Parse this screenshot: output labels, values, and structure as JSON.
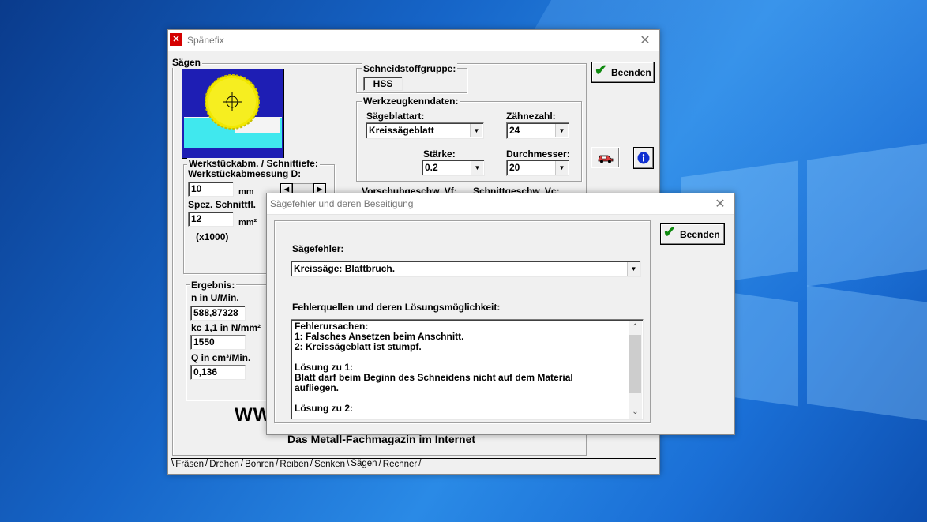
{
  "desktop": {
    "colors": {
      "accent": "#1a6fd6",
      "dark": "#0a3b8c"
    }
  },
  "main_window": {
    "title": "Spänefix",
    "saw_group_label": "Sägen",
    "cutting_material": {
      "label": "Schneidstoffgruppe:",
      "value": "HSS"
    },
    "tool_data": {
      "label": "Werkzeugkenndaten:",
      "blade_type_label": "Sägeblattart:",
      "blade_type_value": "Kreissägeblatt",
      "teeth_label": "Zähnezahl:",
      "teeth_value": "24",
      "thickness_label": "Stärke:",
      "thickness_value": "0.2",
      "diameter_label": "Durchmesser:",
      "diameter_value": "20"
    },
    "workpiece": {
      "label": "Werkstückabm. / Schnittiefe:",
      "dimension_label": "Werkstückabmessung D:",
      "dimension_value": "10",
      "dimension_unit": "mm",
      "specific_label": "Spez. Schnittfl.",
      "specific_value": "12",
      "specific_unit": "mm²",
      "multiplier": "(x1000)"
    },
    "feed_label": "Vorschubgeschw. Vf:",
    "cut_speed_label": "Schnittgeschw. Vc:",
    "result": {
      "label": "Ergebnis:",
      "n_label": "n in U/Min.",
      "n_value": "588,87328",
      "kc_label": "kc 1,1 in N/mm²",
      "kc_value": "1550",
      "q_label": "Q in cm³/Min.",
      "q_value": "0,136"
    },
    "banner_fragment": "WW",
    "tagline": "Das Metall-Fachmagazin im Internet",
    "end_button": "Beenden",
    "tabs": [
      "Fräsen",
      "Drehen",
      "Bohren",
      "Reiben",
      "Senken",
      "Sägen",
      "Rechner"
    ],
    "active_tab": "Sägen"
  },
  "dialog": {
    "title": "Sägefehler und deren Beseitigung",
    "fault_label": "Sägefehler:",
    "fault_value": "Kreissäge: Blattbruch.",
    "sources_label": "Fehlerquellen und deren Lösungsmöglichkeit:",
    "sources_text": "Fehlerursachen:\n1: Falsches Ansetzen beim Anschnitt.\n2: Kreissägeblatt ist stumpf.\n\nLösung zu 1:\nBlatt darf beim Beginn des Schneidens nicht auf dem Material\naufliegen.\n\nLösung zu 2:",
    "end_button": "Beenden"
  }
}
